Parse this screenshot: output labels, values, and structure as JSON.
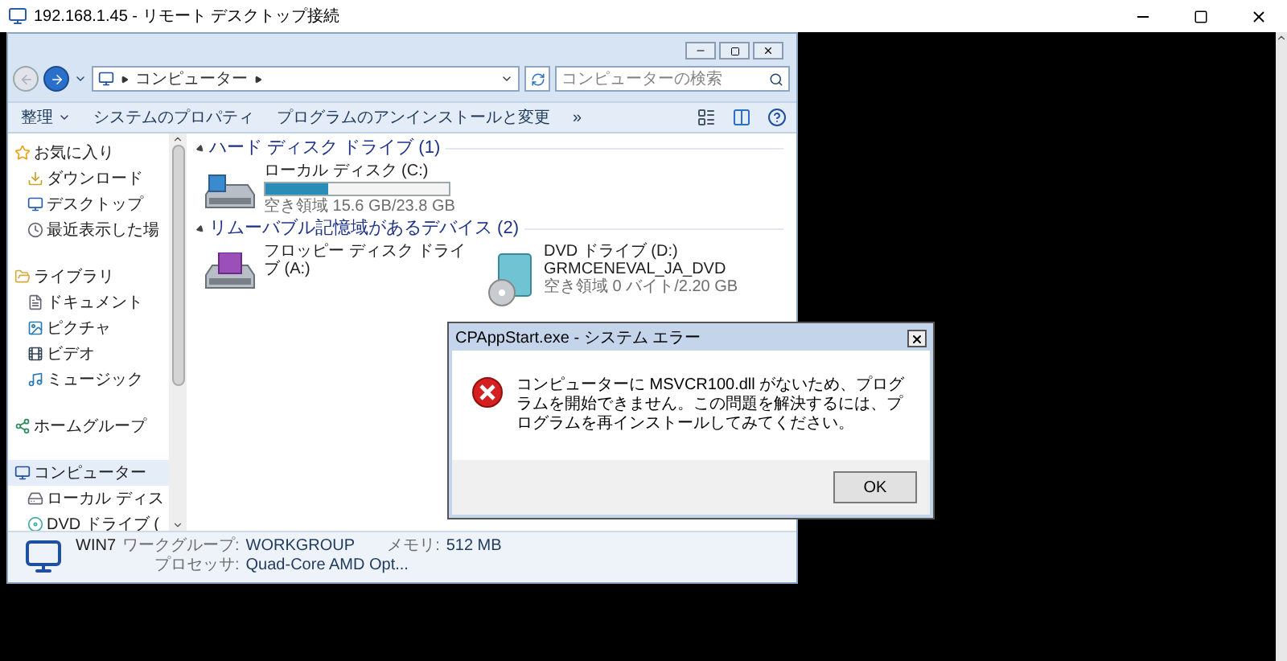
{
  "window": {
    "title": "192.168.1.45 - リモート デスクトップ接続"
  },
  "explorer": {
    "address": [
      "コンピューター"
    ],
    "search": {
      "placeholder": "コンピューターの検索"
    },
    "toolbar": [
      {
        "label": "整理",
        "kind": "menu"
      },
      {
        "label": "システムのプロパティ",
        "kind": "button"
      },
      {
        "label": "プログラムのアンインストールと変更",
        "kind": "button"
      },
      {
        "label": "»",
        "kind": "button"
      }
    ],
    "sidebar": [
      {
        "label": "お気に入り",
        "kind": "star",
        "selected": false,
        "children": [
          {
            "label": "ダウンロード",
            "kind": "download",
            "selected": false
          },
          {
            "label": "デスクトップ",
            "kind": "desktop",
            "selected": false
          },
          {
            "label": "最近表示した場",
            "kind": "recent",
            "selected": false
          }
        ]
      },
      {
        "label": "ライブラリ",
        "kind": "library",
        "selected": false,
        "children": [
          {
            "label": "ドキュメント",
            "kind": "document",
            "selected": false
          },
          {
            "label": "ピクチャ",
            "kind": "picture",
            "selected": false
          },
          {
            "label": "ビデオ",
            "kind": "video",
            "selected": false
          },
          {
            "label": "ミュージック",
            "kind": "music",
            "selected": false
          }
        ]
      },
      {
        "label": "ホームグループ",
        "kind": "homegroup",
        "selected": false
      },
      {
        "label": "コンピューター",
        "kind": "computer",
        "selected": true,
        "children": [
          {
            "label": "ローカル ディス",
            "kind": "disk",
            "selected": false
          },
          {
            "label": "DVD ドライブ (",
            "kind": "dvd",
            "selected": false
          }
        ]
      }
    ],
    "sections": [
      {
        "title": "ハード ディスク ドライブ (1)",
        "items": [
          {
            "kind": "disk",
            "name": "ローカル ディスク (C:)",
            "level": 0.34,
            "free": "空き領域 15.6 GB/23.8 GB"
          }
        ]
      },
      {
        "title": "リムーバブル記憶域があるデバイス (2)",
        "items": [
          {
            "kind": "floppy",
            "name": "フロッピー ディスク ドライブ (A:)"
          },
          {
            "kind": "dvd",
            "name": "DVD ドライブ (D:)",
            "label": "GRMCENEVAL_JA_DVD",
            "free": "空き領域 0 バイト/2.20 GB"
          }
        ]
      }
    ],
    "details": {
      "name": "WIN7",
      "workgroup_label": "ワークグループ:",
      "workgroup": "WORKGROUP",
      "memory_label": "メモリ:",
      "memory": "512 MB",
      "processor_label": "プロセッサ:",
      "processor": "Quad-Core AMD Opt..."
    }
  },
  "dialog": {
    "title": "CPAppStart.exe - システム エラー",
    "message": "コンピューターに MSVCR100.dll がないため、プログラムを開始できません。この問題を解決するには、プログラムを再インストールしてみてください。",
    "button": "OK"
  }
}
